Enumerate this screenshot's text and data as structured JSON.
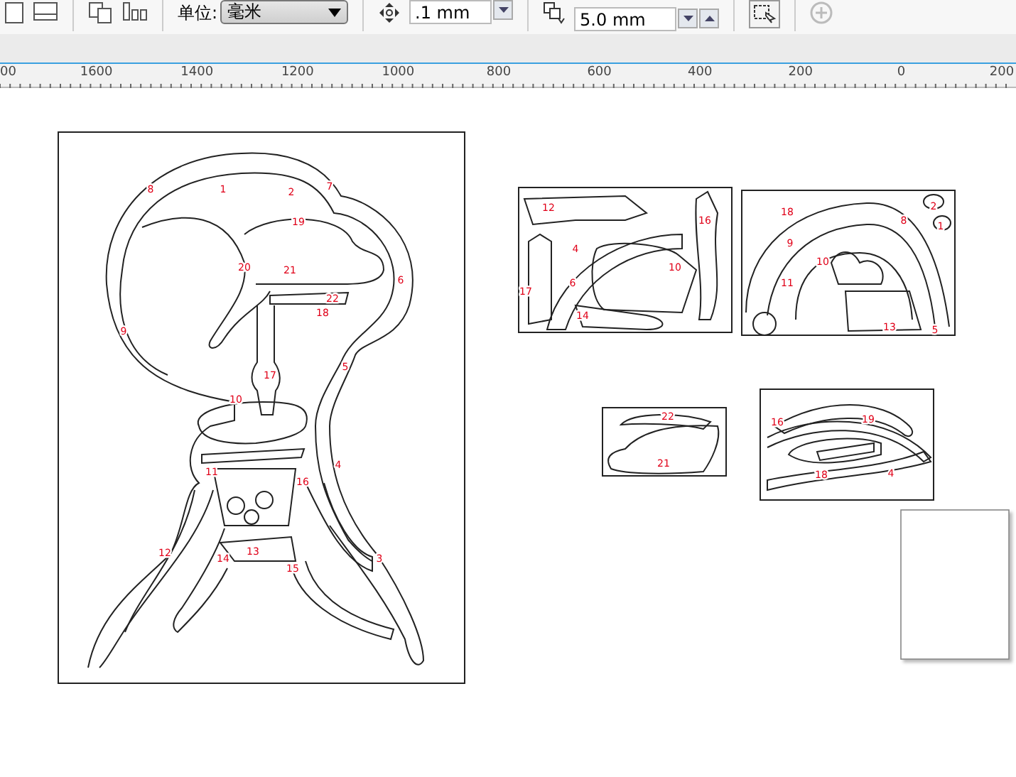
{
  "toolbar": {
    "unit_label": "单位:",
    "unit_dropdown": "毫米",
    "nudge_field": ".1 mm",
    "duplicate_field": "5.0 mm"
  },
  "ruler": {
    "labels": [
      "00",
      "1600",
      "1400",
      "1200",
      "1000",
      "800",
      "600",
      "400",
      "200",
      "0",
      "200"
    ]
  },
  "canvas": {
    "pages": [
      {
        "kind": "main-figure",
        "labels": [
          "8",
          "1",
          "2",
          "7",
          "19",
          "20",
          "21",
          "6",
          "22",
          "18",
          "9",
          "5",
          "17",
          "10",
          "4",
          "11",
          "16",
          "12",
          "14",
          "13",
          "15",
          "3"
        ]
      },
      {
        "kind": "parts-sheet-a",
        "labels": [
          "12",
          "16",
          "4",
          "6",
          "17",
          "10",
          "14"
        ]
      },
      {
        "kind": "parts-sheet-b",
        "labels": [
          "2",
          "18",
          "8",
          "1",
          "9",
          "10",
          "11",
          "13",
          "5"
        ]
      },
      {
        "kind": "parts-sheet-c",
        "labels": [
          "22",
          "21"
        ]
      },
      {
        "kind": "parts-sheet-d",
        "labels": [
          "16",
          "19",
          "18",
          "4"
        ]
      },
      {
        "kind": "blank-page"
      }
    ]
  }
}
